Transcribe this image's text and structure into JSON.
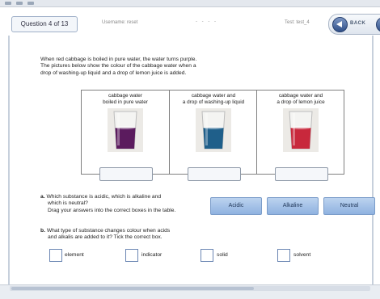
{
  "header": {
    "question_counter": "Question 4 of 13",
    "username": "Username: reset",
    "center_marks": "- - - -",
    "test_name": "Test: test_4",
    "back_label": "BACK"
  },
  "intro": {
    "line1": "When red cabbage is boiled in pure water, the water turns purple.",
    "line2": "The pictures below show the colour of the cabbage water when a",
    "line3": "drop of washing-up liquid and a drop of lemon juice is added."
  },
  "table": {
    "columns": [
      {
        "line1": "cabbage water",
        "line2": "boiled in pure water",
        "liquid_color": "#5b1b5e"
      },
      {
        "line1": "cabbage water and",
        "line2": "a drop of washing-up liquid",
        "liquid_color": "#1f5f8a"
      },
      {
        "line1": "cabbage water and",
        "line2": "a drop of lemon juice",
        "liquid_color": "#c8283c"
      }
    ]
  },
  "question_a": {
    "letter": "a.",
    "line1": "Which substance is acidic, which is alkaline and",
    "line2": "which is neutral?",
    "line3": "Drag your answers into the correct boxes in the table."
  },
  "drag_buttons": [
    "Acidic",
    "Alkaline",
    "Neutral"
  ],
  "question_b": {
    "letter": "b.",
    "line1": "What type of substance changes colour when acids",
    "line2": "and alkalis are added to it?  Tick the correct box."
  },
  "choices": [
    "element",
    "indicator",
    "solid",
    "solvent"
  ],
  "colors": {
    "accent": "#8fb2e0",
    "nav_button": "#2f4f88"
  }
}
